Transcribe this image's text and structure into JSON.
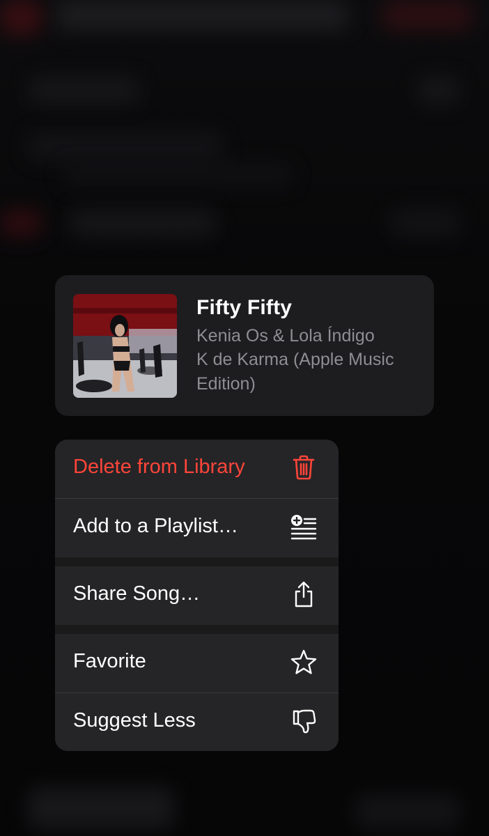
{
  "song": {
    "title": "Fifty Fifty",
    "artist": "Kenia Os & Lola Índigo",
    "album": "K de Karma (Apple Music Edition)"
  },
  "menu": {
    "items": [
      {
        "label": "Delete from Library",
        "icon": "trash-icon",
        "color": "#ff453a"
      },
      {
        "label": "Add to a Playlist…",
        "icon": "add-to-playlist-icon",
        "color": "#ffffff"
      },
      {
        "label": "Share Song…",
        "icon": "share-icon",
        "color": "#ffffff"
      },
      {
        "label": "Favorite",
        "icon": "star-icon",
        "color": "#ffffff"
      },
      {
        "label": "Suggest Less",
        "icon": "thumbs-down-icon",
        "color": "#ffffff"
      }
    ]
  },
  "colors": {
    "destructive": "#ff453a",
    "card_background": "#1d1d1f",
    "secondary_text": "#8e8e93"
  }
}
